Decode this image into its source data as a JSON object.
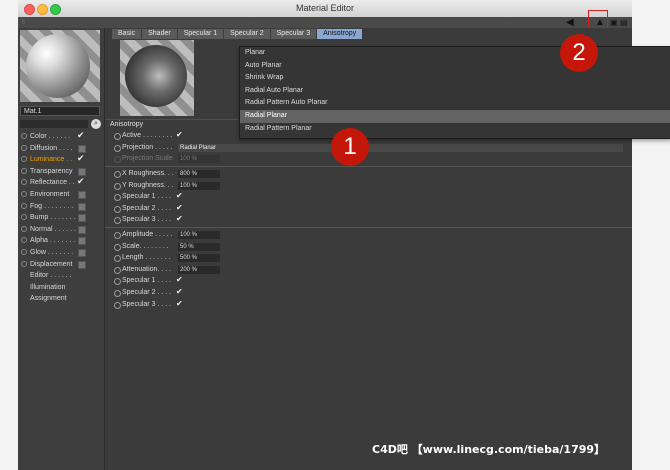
{
  "window": {
    "title": "Material Editor"
  },
  "left": {
    "material_name": "Mat.1",
    "channels": [
      {
        "label": "Color",
        "dots": ". . . . . .",
        "checked": true,
        "active": false
      },
      {
        "label": "Diffusion",
        "dots": ". . . .",
        "checked": false,
        "active": false
      },
      {
        "label": "Luminance",
        "dots": ". .",
        "checked": true,
        "active": true
      },
      {
        "label": "Transparency",
        "dots": "",
        "checked": false,
        "active": false
      },
      {
        "label": "Reflectance",
        "dots": ". .",
        "checked": true,
        "active": false
      },
      {
        "label": "Environment",
        "dots": "",
        "checked": false,
        "active": false
      },
      {
        "label": "Fog",
        "dots": ". . . . . . . .",
        "checked": false,
        "active": false
      },
      {
        "label": "Bump",
        "dots": ". . . . . . .",
        "checked": false,
        "active": false
      },
      {
        "label": "Normal",
        "dots": ". . . . . .",
        "checked": false,
        "active": false
      },
      {
        "label": "Alpha",
        "dots": ". . . . . . .",
        "checked": false,
        "active": false
      },
      {
        "label": "Glow",
        "dots": ". . . . . . .",
        "checked": false,
        "active": false
      },
      {
        "label": "Displacement",
        "dots": "",
        "checked": false,
        "active": false
      }
    ],
    "subitems": [
      "Editor . . . . . .",
      "Illumination",
      "Assignment"
    ]
  },
  "tabs": [
    "Basic",
    "Shader",
    "Specular 1",
    "Specular 2",
    "Specular 3",
    "Anisotropy"
  ],
  "active_tab": "Anisotropy",
  "section_title": "Anisotropy",
  "props": {
    "active_label": "Active . . . . . . . .",
    "projection_label": "Projection . . . . .",
    "projection_value": "Radial Planar",
    "projection_scale_label": "Projection Scale",
    "projection_scale_value": "100 %",
    "x_roughness_label": "X Roughness. . .",
    "x_roughness_value": "800 %",
    "y_roughness_label": "Y Roughness. . .",
    "y_roughness_value": "100 %",
    "spec1_label": "Specular 1 . . . .",
    "spec2_label": "Specular 2 . . . .",
    "spec3_label": "Specular 3 . . . .",
    "amplitude_label": "Amplitude . . . . .",
    "amplitude_value": "100 %",
    "scale_label": "Scale. . . . . . . .",
    "scale_value": "50 %",
    "length_label": "Length . . . . . . .",
    "length_value": "500 %",
    "attenuation_label": "Attenuation. . . .",
    "attenuation_value": "200 %",
    "spec1b_label": "Specular 1 . . . .",
    "spec2b_label": "Specular 2 . . . .",
    "spec3b_label": "Specular 3 . . . ."
  },
  "dropdown": {
    "options": [
      "Planar",
      "Auto Planar",
      "Shrink Wrap",
      "Radial Auto Planar",
      "Radial Pattern Auto Planar",
      "Radial Planar",
      "Radial Pattern Planar"
    ],
    "selected_index": 5
  },
  "annotations": {
    "marker1": "1",
    "marker2": "2"
  },
  "watermark": "C4D吧 【www.linecg.com/tieba/1799】",
  "colors": {
    "active_tab": "#8aa7d2",
    "active_channel": "#f5a000",
    "marker": "#c4170a"
  },
  "icons": {
    "check": "✔",
    "arrow_left": "◀",
    "arrow_up": "▲"
  }
}
